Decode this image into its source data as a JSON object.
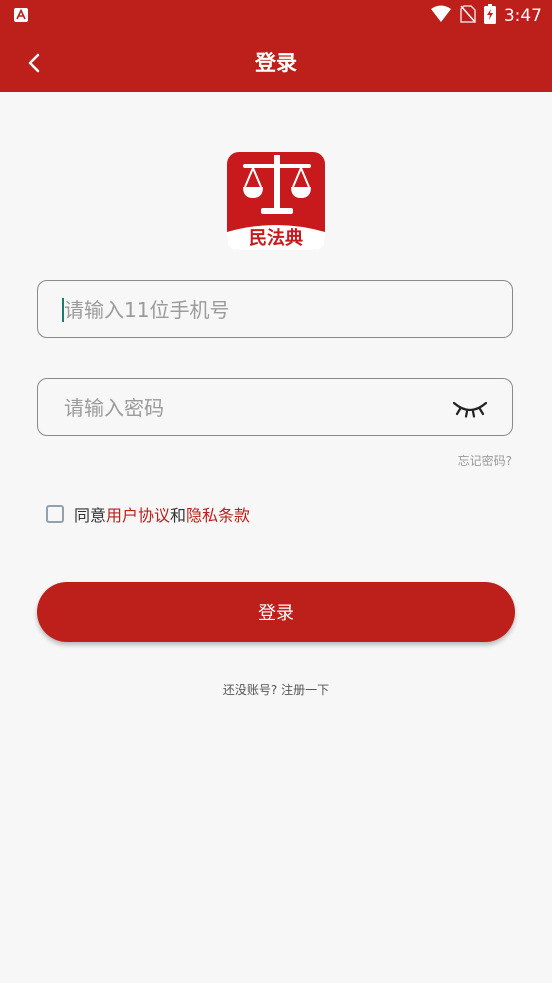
{
  "status_bar": {
    "time": "3:47"
  },
  "header": {
    "title": "登录"
  },
  "logo": {
    "text": "民法典"
  },
  "phone_field": {
    "placeholder": "请输入11位手机号",
    "value": ""
  },
  "password_field": {
    "placeholder": "请输入密码",
    "value": ""
  },
  "forgot_password": "忘记密码?",
  "agreement": {
    "prefix": "同意",
    "user_agreement": "用户协议",
    "and": "和",
    "privacy_policy": "隐私条款",
    "checked": false
  },
  "login_button": "登录",
  "register_link": "还没账号? 注册一下",
  "colors": {
    "primary": "#bd1f1b",
    "background": "#f7f7f7"
  }
}
